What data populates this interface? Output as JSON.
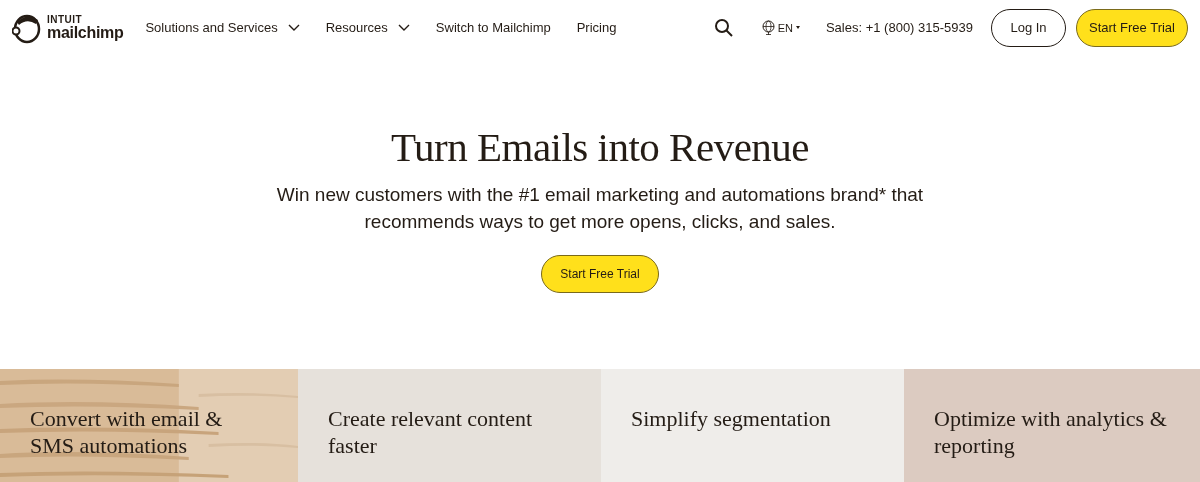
{
  "logo": {
    "top": "INTUIT",
    "bottom": "mailchimp"
  },
  "nav": [
    {
      "label": "Solutions and Services",
      "dropdown": true
    },
    {
      "label": "Resources",
      "dropdown": true
    },
    {
      "label": "Switch to Mailchimp",
      "dropdown": false
    },
    {
      "label": "Pricing",
      "dropdown": false
    }
  ],
  "language": "EN",
  "sales": "Sales: +1 (800) 315-5939",
  "login": "Log In",
  "trial": "Start Free Trial",
  "hero": {
    "title": "Turn Emails into Revenue",
    "subtitle": "Win new customers with the #1 email marketing and automations brand* that recommends ways to get more opens, clicks, and sales.",
    "button": "Start Free Trial"
  },
  "features": [
    {
      "title": "Convert with email & SMS automations",
      "kind": "picture"
    },
    {
      "title": "Create relevant content faster",
      "kind": "plain"
    },
    {
      "title": "Simplify segmentation",
      "kind": "plain"
    },
    {
      "title": "Optimize with analytics & reporting",
      "kind": "plain"
    }
  ]
}
